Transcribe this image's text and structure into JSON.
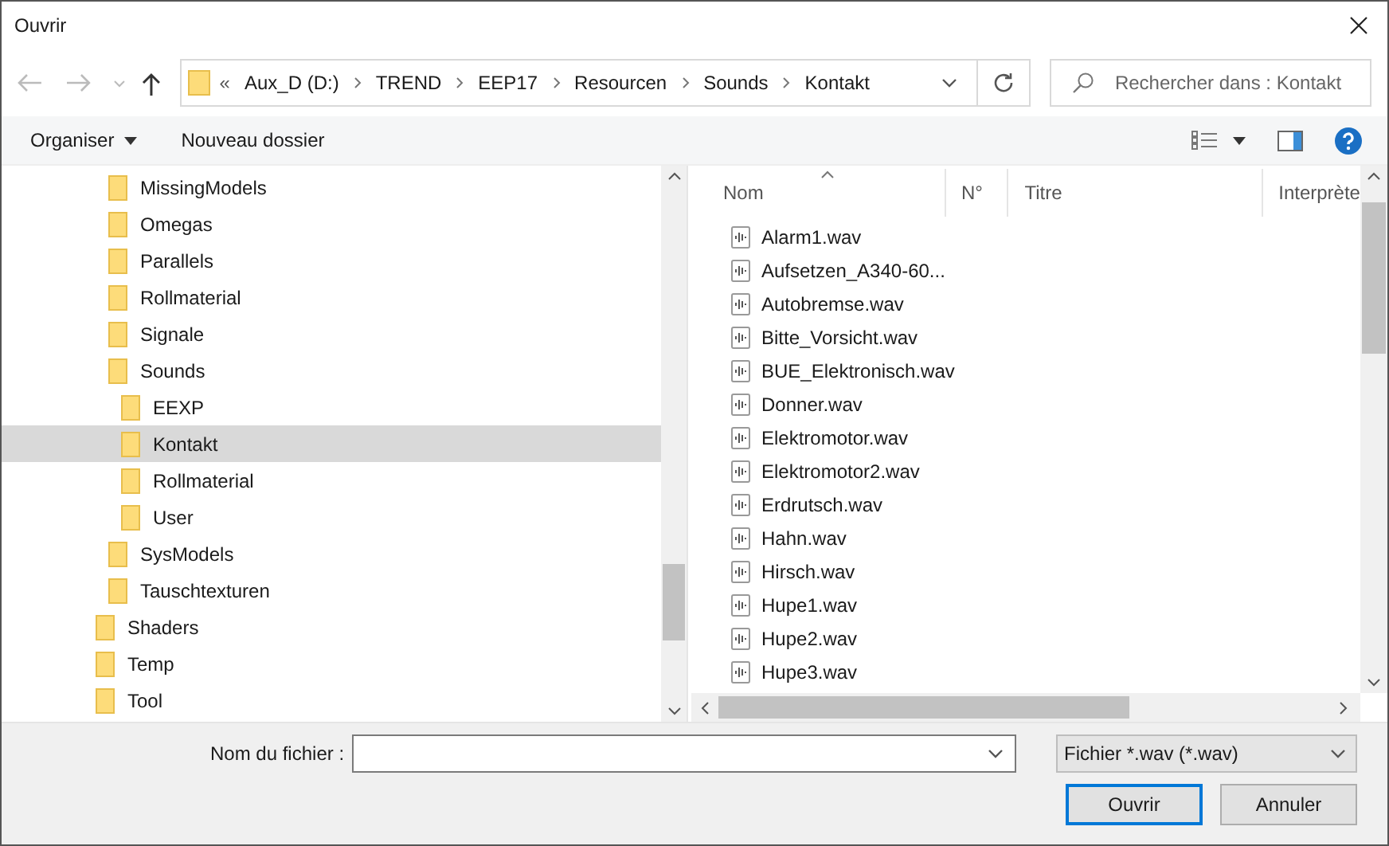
{
  "window": {
    "title": "Ouvrir"
  },
  "address": {
    "overflow": "«",
    "crumbs": [
      "Aux_D (D:)",
      "TREND",
      "EEP17",
      "Resourcen",
      "Sounds",
      "Kontakt"
    ]
  },
  "search": {
    "placeholder": "Rechercher dans : Kontakt"
  },
  "toolbar": {
    "organize": "Organiser",
    "new_folder": "Nouveau dossier"
  },
  "tree": [
    {
      "children": [
        {
          "label": "MissingModels",
          "selected": false
        },
        {
          "label": "Omegas",
          "selected": false
        },
        {
          "label": "Parallels",
          "selected": false
        },
        {
          "label": "Rollmaterial",
          "selected": false
        },
        {
          "label": "Signale",
          "selected": false
        },
        {
          "label": "Sounds",
          "selected": false,
          "children": [
            {
              "label": "EEXP",
              "selected": false
            },
            {
              "label": "Kontakt",
              "selected": true
            },
            {
              "label": "Rollmaterial",
              "selected": false
            },
            {
              "label": "User",
              "selected": false
            }
          ]
        },
        {
          "label": "SysModels",
          "selected": false
        },
        {
          "label": "Tauschtexturen",
          "selected": false
        }
      ]
    },
    {
      "label": "Shaders",
      "selected": false
    },
    {
      "label": "Temp",
      "selected": false
    },
    {
      "label": "Tool",
      "selected": false
    }
  ],
  "columns": [
    "Nom",
    "N°",
    "Titre",
    "Interprète"
  ],
  "files": [
    "Alarm1.wav",
    "Aufsetzen_A340-60...",
    "Autobremse.wav",
    "Bitte_Vorsicht.wav",
    "BUE_Elektronisch.wav",
    "Donner.wav",
    "Elektromotor.wav",
    "Elektromotor2.wav",
    "Erdrutsch.wav",
    "Hahn.wav",
    "Hirsch.wav",
    "Hupe1.wav",
    "Hupe2.wav",
    "Hupe3.wav"
  ],
  "footer": {
    "filename_label": "Nom du fichier :",
    "filter": "Fichier *.wav (*.wav)",
    "open": "Ouvrir",
    "cancel": "Annuler"
  }
}
